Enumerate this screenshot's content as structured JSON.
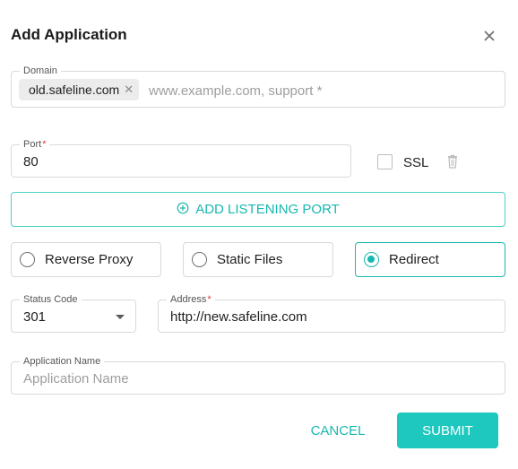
{
  "dialog": {
    "title": "Add Application"
  },
  "domain": {
    "label": "Domain",
    "chips": [
      "old.safeline.com"
    ],
    "placeholder": "www.example.com, support *"
  },
  "port": {
    "label": "Port",
    "required_mark": "*",
    "value": "80"
  },
  "ssl": {
    "label": "SSL",
    "checked": false
  },
  "add_port": {
    "label": "ADD LISTENING PORT"
  },
  "modes": [
    {
      "label": "Reverse Proxy",
      "selected": false
    },
    {
      "label": "Static Files",
      "selected": false
    },
    {
      "label": "Redirect",
      "selected": true
    }
  ],
  "status_code": {
    "label": "Status Code",
    "value": "301"
  },
  "address": {
    "label": "Address",
    "required_mark": "*",
    "value": "http://new.safeline.com"
  },
  "app_name": {
    "label": "Application Name",
    "placeholder": "Application Name"
  },
  "actions": {
    "cancel": "CANCEL",
    "submit": "SUBMIT"
  },
  "colors": {
    "accent": "#18b8b0",
    "submit_bg": "#1ec8bf",
    "required": "#e53935"
  },
  "icons": {
    "close": "close-icon",
    "delete": "trash-icon",
    "add": "plus-circle-icon",
    "dropdown": "caret-down-icon"
  }
}
